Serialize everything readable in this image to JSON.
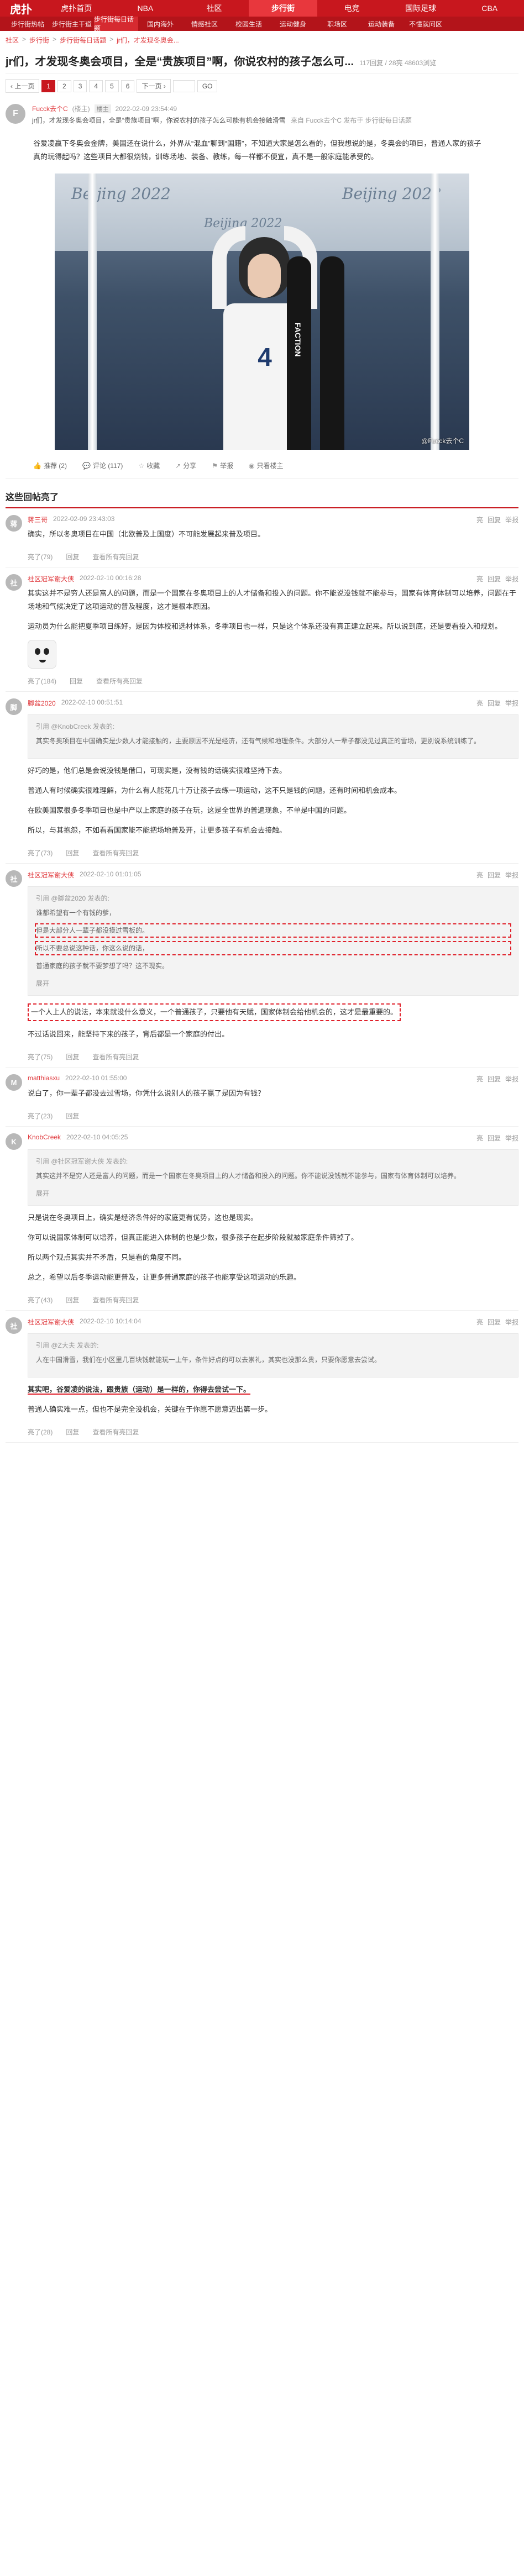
{
  "nav": {
    "logo": "虎扑",
    "items": [
      "虎扑首页",
      "NBA",
      "社区",
      "步行街",
      "电竞",
      "国际足球",
      "CBA"
    ],
    "active_index": 3
  },
  "subnav": {
    "items": [
      "步行街热帖",
      "步行街主干道",
      "步行街每日话题",
      "国内海外",
      "情感社区",
      "校园生活",
      "运动健身",
      "职场区",
      "运动装备",
      "不懂就问区"
    ],
    "active_index": 2
  },
  "breadcrumb": [
    "社区",
    "步行街",
    "步行街每日话题",
    "jr们，才发现冬奥会..."
  ],
  "thread": {
    "title": "jr们，才发现冬奥会项目，全是“贵族项目”啊，你说农村的孩子怎么可...",
    "stats": "117回复 / 28亮 48603浏览"
  },
  "pager": {
    "prev": "‹ 上一页",
    "pages": [
      "1",
      "2",
      "3",
      "4",
      "5",
      "6"
    ],
    "current": "1",
    "next": "下一页 ›",
    "jump_placeholder": "",
    "go": "GO"
  },
  "main_post": {
    "author": "Fucck去个C",
    "author_tag": "(楼主)",
    "floor": "楼主",
    "time": "2022-02-09 23:54:49",
    "source_lead": "jr们，才发现冬奥会项目，全是“贵族项目”啊，你说农村的孩子怎么可能有机会接触滑雪",
    "source_tail": "来自 Fucck去个C 发布于 步行街每日话题",
    "content": "谷爱凌赢下冬奥会金牌，美国还在说什么，外界从“混血”聊到“国籍”，不知道大家是怎么看的，但我想说的是，冬奥会的项目，普通人家的孩子真的玩得起吗？这些项目大都很烧钱，训练场地、装备、教练，每一样都不便宜，真不是一般家庭能承受的。",
    "photo_watermark": "@Fucck去个C",
    "photo_banner": "Beijing 2022",
    "photo_bib": "4",
    "photo_ski_brand": "FACTION",
    "actions": {
      "light": "推荐 (2)",
      "reply": "评论 (117)",
      "favorite": "收藏",
      "share": "分享",
      "report": "举报",
      "only_author": "只看楼主"
    }
  },
  "replies_title": "这些回帖亮了",
  "replies": [
    {
      "user": "蒋三哥",
      "time": "2022-02-09 23:43:03",
      "text": "确实，所以冬奥项目在中国（北欧普及上国度）不可能发展起来普及项目。",
      "foot": [
        "亮了(79)",
        "回复",
        "查看所有亮回复"
      ]
    },
    {
      "user": "社区冠军谢大侠",
      "time": "2022-02-10 00:16:28",
      "text": "其实这并不是穷人还是富人的问题，而是一个国家在冬奥项目上的人才储备和投入的问题。你不能说没钱就不能参与，国家有体育体制可以培养，问题在于场地和气候决定了这项运动的普及程度，这才是根本原因。",
      "text2": "运动员为什么能把夏季项目练好，是因为体校和选材体系，冬季项目也一样，只是这个体系还没有真正建立起来。所以说到底，还是要看投入和规划。",
      "has_sticker": true,
      "foot": [
        "亮了(184)",
        "回复",
        "查看所有亮回复"
      ]
    },
    {
      "user": "脚盆2020",
      "time": "2022-02-10 00:51:51",
      "quote_head": "引用 @KnobCreek 发表的:",
      "quote": "其实冬奥项目在中国确实是少数人才能接触的，主要原因不光是经济，还有气候和地理条件。大部分人一辈子都没见过真正的雪场，更别说系统训练了。",
      "text": "好巧的是，他们总是会说没钱是借口，可现实是，没有钱的话确实很难坚持下去。",
      "text2": "普通人有时候确实很难理解，为什么有人能花几十万让孩子去练一项运动，这不只是钱的问题，还有时间和机会成本。",
      "text3": "在欧美国家很多冬季项目也是中产以上家庭的孩子在玩，这是全世界的普遍现象，不单是中国的问题。",
      "text4": "所以，与其抱怨，不如看看国家能不能把场地普及开，让更多孩子有机会去接触。",
      "foot": [
        "亮了(73)",
        "回复",
        "查看所有亮回复"
      ]
    },
    {
      "user": "社区冠军谢大侠",
      "time": "2022-02-10 01:01:05",
      "quote_head": "引用 @脚盆2020 发表的:",
      "quote_lines": [
        "谁都希望有一个有钱的爹，",
        "但是大部分人一辈子都没摸过雪板的。",
        "所以不要总说这种话，你这么说的话，",
        "普通家庭的孩子就不要梦想了吗？这不现实。"
      ],
      "quote_more": "展开",
      "boxed_text": "一个人上人的说法，本来就没什么意义，一个普通孩子，只要他有天赋，国家体制会给他机会的，这才是最重要的。",
      "text": "不过话说回来，能坚持下来的孩子，背后都是一个家庭的付出。",
      "foot": [
        "亮了(75)",
        "回复",
        "查看所有亮回复"
      ]
    },
    {
      "user": "matthiasxu",
      "time": "2022-02-10 01:55:00",
      "text": "说白了，你一辈子都没去过雪场，你凭什么说别人的孩子赢了是因为有钱？",
      "foot": [
        "亮了(23)",
        "回复"
      ]
    },
    {
      "user": "KnobCreek",
      "time": "2022-02-10 04:05:25",
      "quote_head": "引用 @社区冠军谢大侠 发表的:",
      "quote": "其实这并不是穷人还是富人的问题，而是一个国家在冬奥项目上的人才储备和投入的问题。你不能说没钱就不能参与，国家有体育体制可以培养。",
      "quote_more": "展开",
      "text": "只是说在冬奥项目上，确实是经济条件好的家庭更有优势，这也是现实。",
      "text2": "你可以说国家体制可以培养，但真正能进入体制的也是少数，很多孩子在起步阶段就被家庭条件筛掉了。",
      "text3": "所以两个观点其实并不矛盾，只是看的角度不同。",
      "text4": "总之，希望以后冬季运动能更普及，让更多普通家庭的孩子也能享受这项运动的乐趣。",
      "foot": [
        "亮了(43)",
        "回复",
        "查看所有亮回复"
      ]
    },
    {
      "user": "社区冠军谢大侠",
      "time": "2022-02-10 10:14:04",
      "quote_head": "引用 @Z大夫 发表的:",
      "quote": "人在中国滑雪，我们在小区里几百块钱就能玩一上午，条件好点的可以去崇礼，其实也没那么贵，只要你愿意去尝试。",
      "underline_text": "其实吧，谷爱凌的说法，跟贵族（运动）是一样的，你得去尝试一下。",
      "text": "普通人确实难一点，但也不是完全没机会，关键在于你愿不愿意迈出第一步。",
      "foot": [
        "亮了(28)",
        "回复",
        "查看所有亮回复"
      ]
    }
  ],
  "icons": {
    "light": "thumb-up-icon",
    "reply": "comment-icon",
    "favorite": "star-icon",
    "share": "share-icon",
    "report": "flag-icon",
    "only_author": "user-icon"
  },
  "colors": {
    "brand": "#c8171e",
    "link": "#e03a3e",
    "highlight": "#e0202a"
  }
}
